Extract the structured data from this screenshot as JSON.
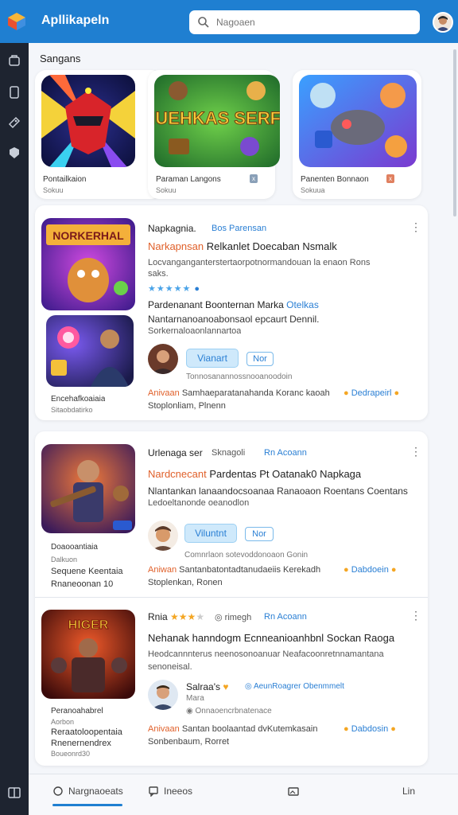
{
  "app": {
    "title": "Apllikapeln",
    "brand_color": "#1f7fd1"
  },
  "search": {
    "placeholder": "Nagoaen"
  },
  "section": {
    "title": "Sangans"
  },
  "featured": [
    {
      "title": "Pontailkaion",
      "sub": "Sokuu",
      "tag": ""
    },
    {
      "title": "Paraman Langons",
      "sub": "Sokuu",
      "tag": "x"
    },
    {
      "title": "Panenten Bonnaon",
      "sub": "Sokuua",
      "tag": "x"
    }
  ],
  "featured_art_text": "MUEHKAS SERFH",
  "posts": [
    {
      "header": "Napkagnia.",
      "header_link": "Bos Parensan",
      "headline_hl": "Narkapnsan",
      "headline_rest": "Relkanlet Doecaban Nsmalk",
      "body1": "Locvanganganterstertaorpotnormandouan la enaon Rons",
      "body2": "saks.",
      "body3": "Pardenanant Boonternan Marka",
      "body3_link": "Otelkas",
      "body4": "Nantarnanoanoabonsaol epcaurt Dennil.",
      "body5": "Sorkernaloaonlannartoa",
      "btn_fill": "Vianart",
      "btn_outline": "Nor",
      "meta": "Tonnosanannossnooanoodoin",
      "thumb_text": "NORKERHAL",
      "caption1": "Encehafkoaiaia",
      "caption2": "Sitaobdatirko",
      "footer_hl": "Anivaan",
      "footer_mid": "Samhaeparatanahanda Koranc kaoah",
      "footer_link": "Dedrapeirl",
      "footer2": "Stoplonliam, Plnenn"
    },
    {
      "header": "Urlenaga ser",
      "header_mid": "Sknagoli",
      "header_link": "Rn Acoann",
      "headline_hl": "Nardcnecant",
      "headline_rest": "Pardentas Pt Oatanak0 Napkaga",
      "body1": "Nlantankan lanaandocsoanaa Ranaoaon Roentans Coentans",
      "body2": "Ledoeltanonde oeanodlon",
      "btn_fill": "Viluntnt",
      "btn_outline": "Nor",
      "meta": "Comnrlaon sotevoddonoaon Gonin",
      "caption1": "Doaooantiaia",
      "caption1b": "Dalkuon",
      "caption2": "Sequene Keentaia",
      "caption3": "Rnaneoonan 10",
      "footer_hl": "Aniwan",
      "footer_mid": "Santanbatontadtanudaeiis Kerekadh",
      "footer_link": "Dabdoein",
      "footer2": "Stoplenkan, Ronen"
    },
    {
      "header": "Rnia",
      "header_mid": "rimegh",
      "header_link": "Rn Acoann",
      "headline": "Nehanak hanndogm Ecnneanioanhbnl Sockan Raoga",
      "body1": "Heodcannnterus neenosonoanuar Neafacoonretnnamantana",
      "body2": "senoneisal.",
      "author": "Salraa's",
      "author_link": "AeunRoagrer Obenmmelt",
      "author_sub": "Mara",
      "meta": "Onnaoencrbnatenace",
      "thumb_text": "HIGER",
      "caption1": "Peranoahabrel",
      "caption1b": "Aorbon",
      "caption2": "Reraatoloopentaia",
      "caption3": "Rnenernendrex",
      "caption4": "Boueonrd30",
      "footer_hl": "Anivaan",
      "footer_mid": "Santan boolaantad dvKutemkasain",
      "footer_link": "Dabdosin",
      "footer2": "Sonbenbaum, Rorret"
    }
  ],
  "bottom_nav": [
    {
      "label": "Nargnaoeats",
      "active": true
    },
    {
      "label": "Ineeos",
      "active": false
    },
    {
      "label": "",
      "active": false
    },
    {
      "label": "Lin",
      "active": false
    }
  ]
}
